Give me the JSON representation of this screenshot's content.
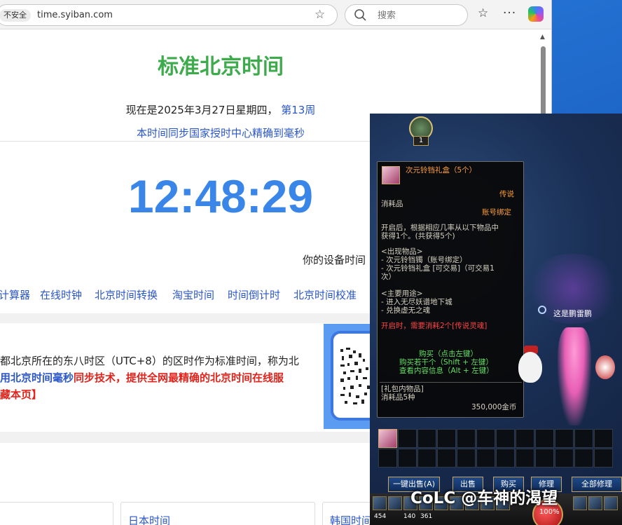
{
  "browser": {
    "security_label": "不安全",
    "url": "time.syiban.com",
    "search_placeholder": "搜索"
  },
  "page": {
    "title": "标准北京时间",
    "date_prefix": "现在是2025年3月27日星期四，",
    "week": "第13周",
    "sync_note": "本时间同步国家授时中心精确到毫秒",
    "clock": "12:48:29",
    "device_time_label": "你的设备时间",
    "nav_links": [
      "计算器",
      "在线时钟",
      "北京时间转换",
      "淘宝时间",
      "时间倒计时",
      "北京时间校准"
    ],
    "intro_line1": "都北京所在的东八时区（UTC+8）的区时作为标准时间，称为北",
    "intro_line2_blue": "用北京时间毫秒",
    "intro_line2_red": "同步技术，提供全网最精确的北京时间在线服",
    "intro_line3": "藏本页】",
    "timezone_cards": [
      "日本时间",
      "韩国时间"
    ]
  },
  "game": {
    "char_level": "1",
    "tooltip": {
      "name": "次元铃铛礼盒（5个）",
      "rarity": "传说",
      "type": "消耗品",
      "binding": "账号绑定",
      "desc_line1": "开启后，根据相应几率从以下物品中",
      "desc_line2": "获得1个。(共获得5个)",
      "items_header": "<出现物品>",
      "item1": "- 次元铃铛镯（账号绑定）",
      "item2": "- 次元铃铛礼盒 [可交易]（可交易1",
      "item2_cont": "次）",
      "use_header": "<主要用途>",
      "use1": "- 进入无尽妖谱地下城",
      "use2": "- 兑换虚无之魂",
      "open_req": "开启时，需要消耗2个[传说灵魂]",
      "buy_click": "购买（点击左键）",
      "buy_multi": "购买若干个（Shift + 左键）",
      "view_contents": "查看内容信息（Alt + 左键）",
      "pack_label": "[礼包内物品]",
      "pack_count": "消耗品5种",
      "price": "350,000金币"
    },
    "npc_label": "这是鹏雷鹏",
    "buttons": [
      "一键出售(A)",
      "出售",
      "购买",
      "修理",
      "全部修理"
    ],
    "skill_numbers": [
      "454",
      "140",
      "361"
    ],
    "hp_text": "100%"
  },
  "watermark": "CoLC @车神的渴望"
}
